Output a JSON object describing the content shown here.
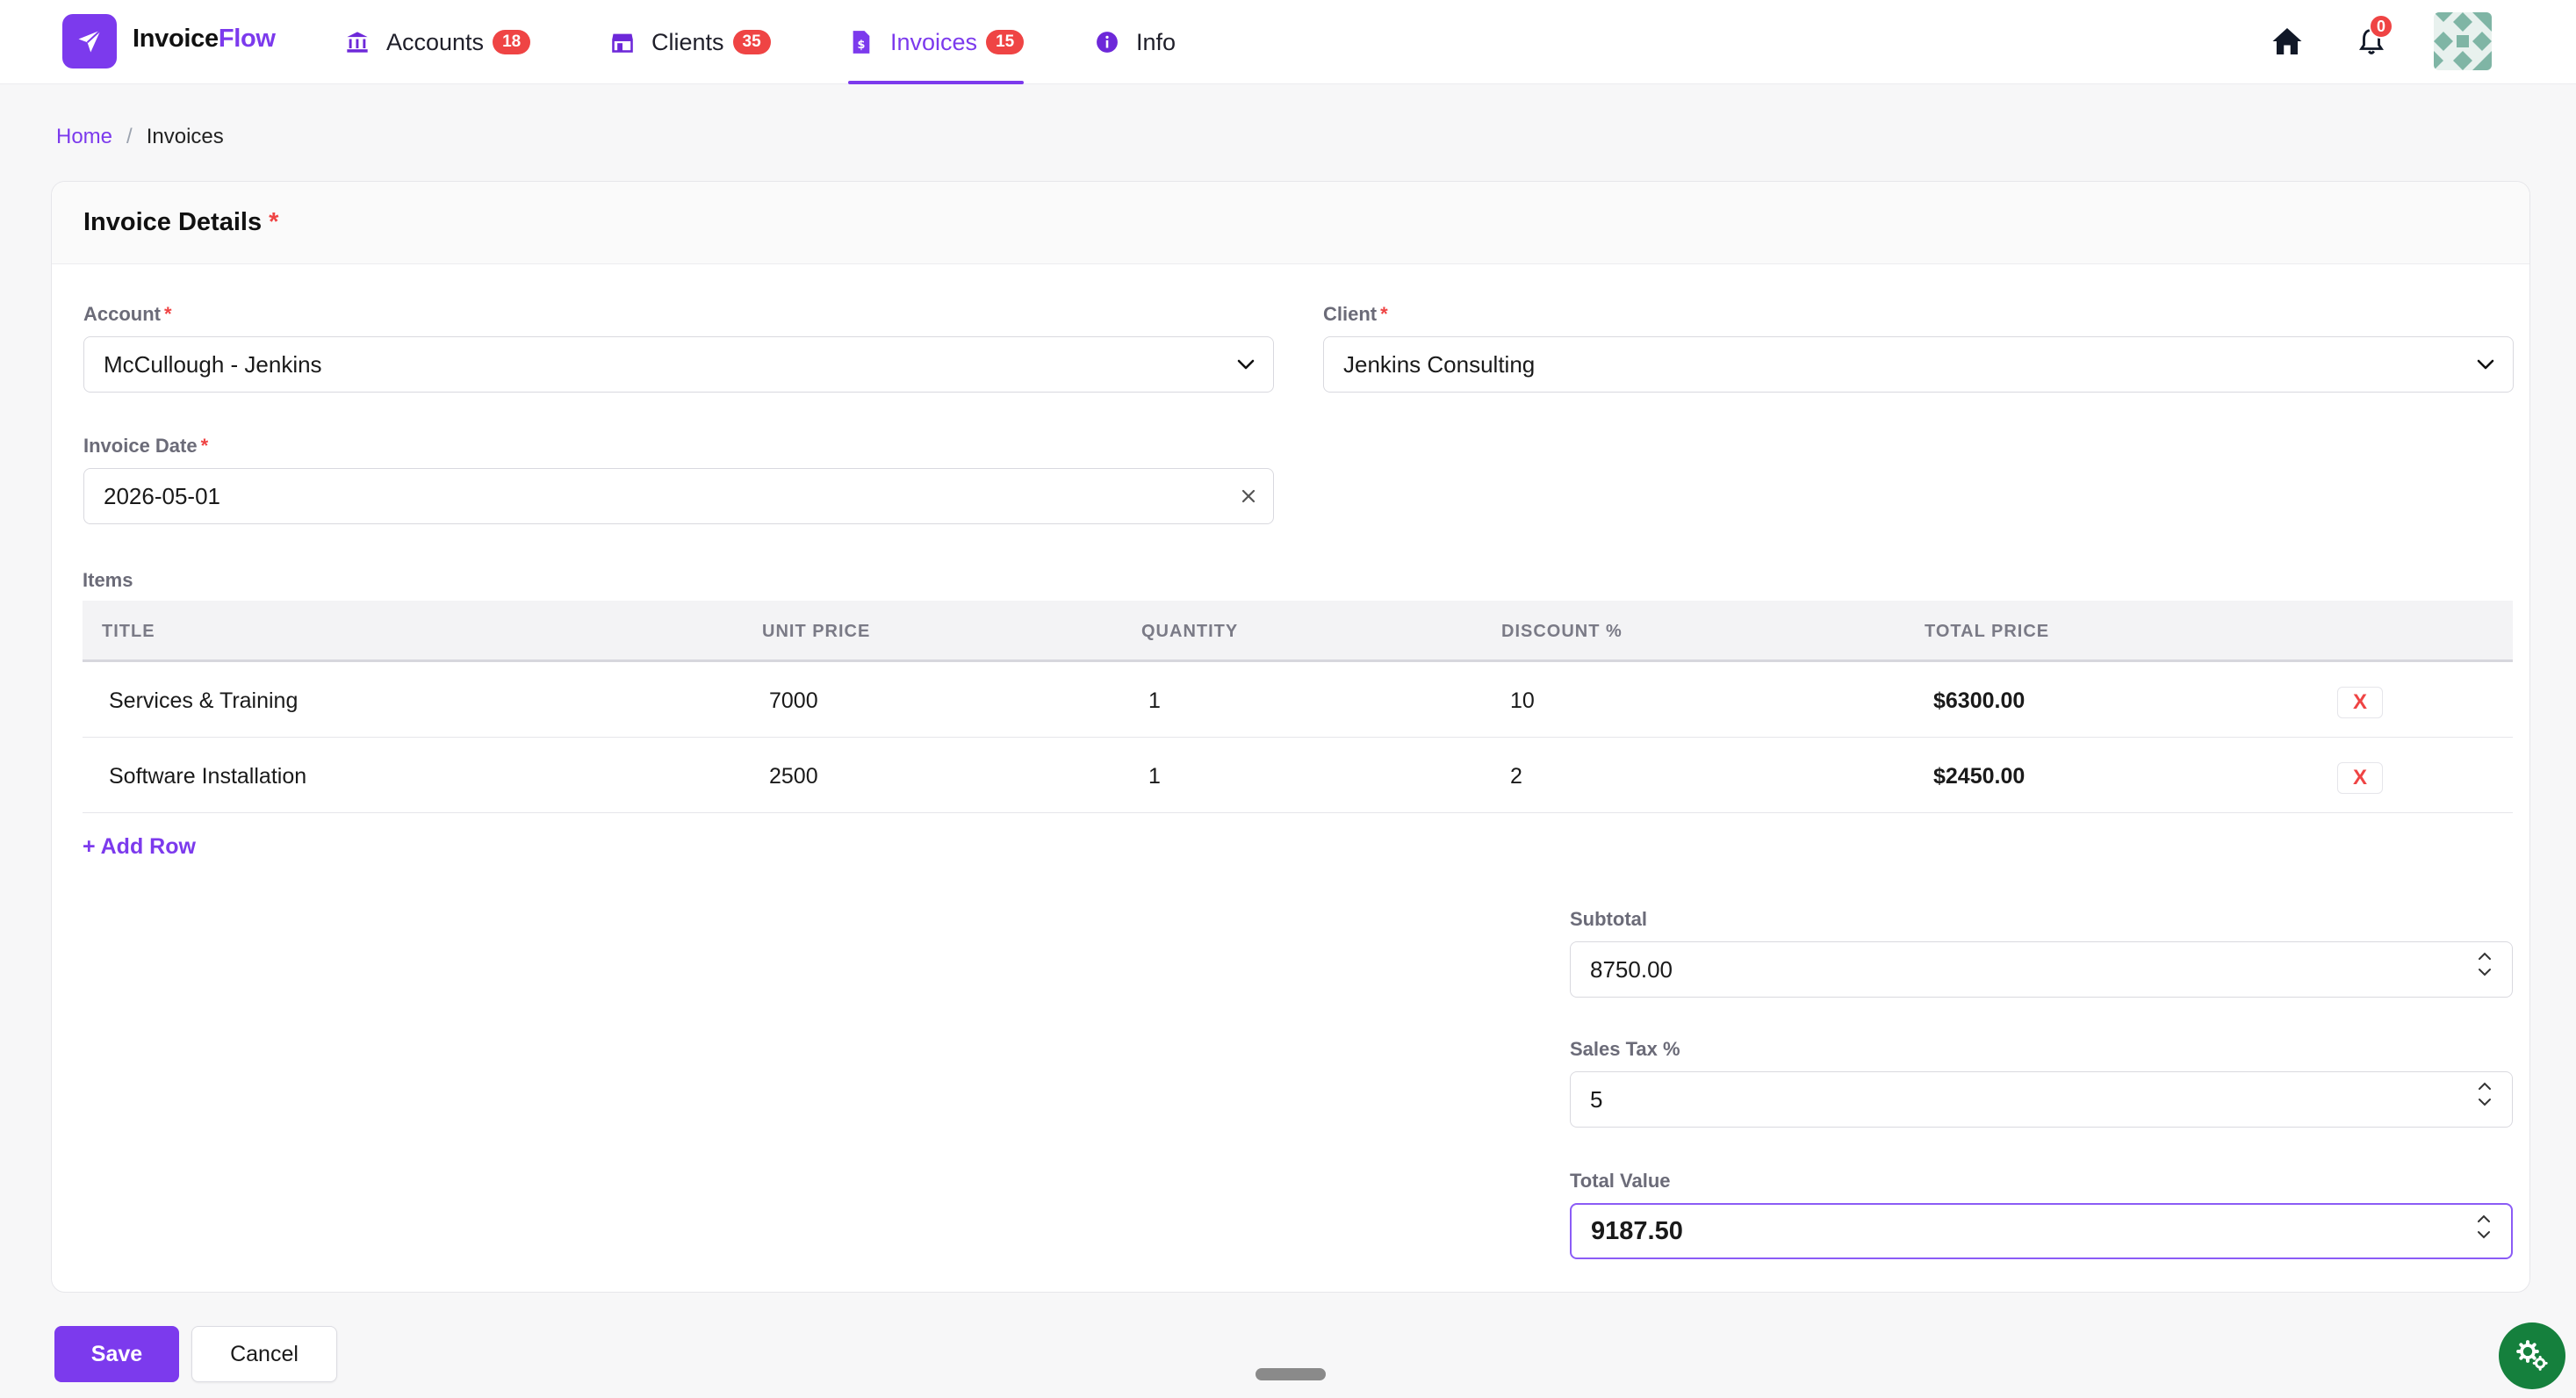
{
  "app": {
    "brand_part1": "Invoice",
    "brand_part2": "Flow"
  },
  "nav": {
    "items": [
      {
        "label": "Accounts",
        "badge": "18",
        "icon": "bank-icon"
      },
      {
        "label": "Clients",
        "badge": "35",
        "icon": "store-icon"
      },
      {
        "label": "Invoices",
        "badge": "15",
        "icon": "invoice-file-icon",
        "active": true
      },
      {
        "label": "Info",
        "icon": "info-icon"
      }
    ],
    "notifications_count": "0"
  },
  "breadcrumb": {
    "home": "Home",
    "separator": "/",
    "current": "Invoices"
  },
  "form": {
    "title": "Invoice Details",
    "required_mark": "*",
    "account": {
      "label": "Account",
      "value": "McCullough - Jenkins"
    },
    "client": {
      "label": "Client",
      "value": "Jenkins Consulting"
    },
    "invoice_date": {
      "label": "Invoice Date",
      "value": "2026-05-01"
    }
  },
  "items": {
    "label": "Items",
    "columns": [
      "TITLE",
      "UNIT PRICE",
      "QUANTITY",
      "DISCOUNT %",
      "TOTAL PRICE"
    ],
    "rows": [
      {
        "title": "Services & Training",
        "unit_price": "7000",
        "quantity": "1",
        "discount": "10",
        "total": "$6300.00",
        "delete_label": "X"
      },
      {
        "title": "Software Installation",
        "unit_price": "2500",
        "quantity": "1",
        "discount": "2",
        "total": "$2450.00",
        "delete_label": "X"
      }
    ],
    "add_row_label": "+ Add Row"
  },
  "totals": {
    "subtotal": {
      "label": "Subtotal",
      "value": "8750.00"
    },
    "sales_tax": {
      "label": "Sales Tax %",
      "value": "5"
    },
    "total_value": {
      "label": "Total Value",
      "value": "9187.50"
    }
  },
  "actions": {
    "save_label": "Save",
    "cancel_label": "Cancel"
  },
  "colors": {
    "accent": "#7c3aed",
    "badge": "#ef4444",
    "fab": "#15803d"
  }
}
